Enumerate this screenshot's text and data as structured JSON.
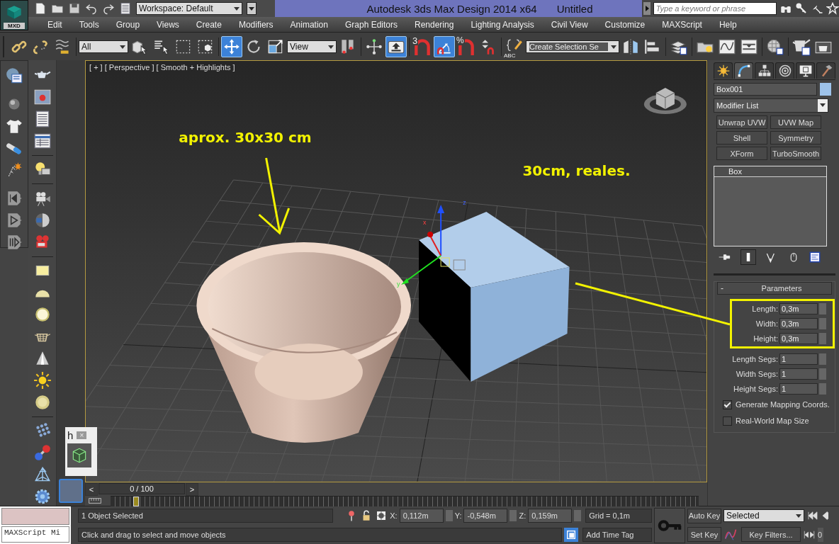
{
  "app_button": {
    "label": "MXD"
  },
  "quick_access": {
    "workspace": "Workspace: Default"
  },
  "window": {
    "title": "Autodesk 3ds Max Design 2014 x64",
    "document": "Untitled"
  },
  "search": {
    "placeholder": "Type a keyword or phrase"
  },
  "menu": [
    "Edit",
    "Tools",
    "Group",
    "Views",
    "Create",
    "Modifiers",
    "Animation",
    "Graph Editors",
    "Rendering",
    "Lighting Analysis",
    "Civil View",
    "Customize",
    "MAXScript",
    "Help"
  ],
  "toolbar": {
    "selection_filter": "All",
    "reference_coord": "View",
    "snap_dimension": "3",
    "percent_sign": "%",
    "named_sets_caption": "ABC",
    "named_selection": "Create Selection Se",
    "tools": [
      {
        "selected": false
      },
      {
        "selected": false
      },
      {
        "selected": false
      },
      {
        "selected": false
      },
      {
        "selected": false
      },
      {
        "selected": false
      },
      {
        "selected": false
      },
      {
        "selected": true
      },
      {
        "selected": false
      },
      {
        "selected": false
      },
      {
        "selected": false
      },
      {
        "selected": false
      },
      {
        "selected": true
      },
      {
        "selected": false
      },
      {
        "selected": true
      },
      {
        "selected": false
      },
      {
        "selected": false
      },
      {
        "selected": false
      },
      {
        "selected": false
      },
      {
        "selected": false
      },
      {
        "selected": false
      },
      {
        "selected": false
      },
      {
        "selected": false
      },
      {
        "selected": false
      },
      {
        "selected": false
      },
      {
        "selected": false
      },
      {
        "selected": false
      }
    ]
  },
  "viewport": {
    "label": "[ + ] [ Perspective ] [ Smooth + Highlights ]",
    "active": true,
    "annotations": [
      "aprox. 30x30 cm",
      "30cm, reales."
    ],
    "gizmo_axes": [
      "z",
      "x",
      "y"
    ]
  },
  "floating_panel": {
    "title": "h",
    "close": "×"
  },
  "command_panel": {
    "tabs": [
      {
        "selected": false
      },
      {
        "selected": true
      },
      {
        "selected": false
      },
      {
        "selected": false
      },
      {
        "selected": false
      },
      {
        "selected": false
      }
    ],
    "object_name": "Box001",
    "modifier_list": "Modifier List",
    "modifier_buttons": [
      "Unwrap UVW",
      "UVW Map",
      "Shell",
      "Symmetry",
      "XForm",
      "TurboSmooth"
    ],
    "stack": [
      {
        "label": "Box",
        "selected": false
      }
    ],
    "rollout": {
      "collapse": "-",
      "title": "Parameters",
      "fields": [
        {
          "label": "Length:",
          "value": "0,3m",
          "highlighted": true
        },
        {
          "label": "Width:",
          "value": "0,3m",
          "highlighted": true
        },
        {
          "label": "Height:",
          "value": "0,3m",
          "highlighted": true
        },
        {
          "label": "Length Segs:",
          "value": "1",
          "highlighted": false
        },
        {
          "label": "Width Segs:",
          "value": "1",
          "highlighted": false
        },
        {
          "label": "Height Segs:",
          "value": "1",
          "highlighted": false
        }
      ],
      "options": [
        {
          "label": "Generate Mapping Coords.",
          "checked": true
        },
        {
          "label": "Real-World Map Size",
          "checked": false
        }
      ]
    }
  },
  "timeline": {
    "prev": "<",
    "frame": "0 / 100",
    "next": ">"
  },
  "status_bar": {
    "listener": "MAXScript Mi",
    "selection": "1 Object Selected",
    "prompt": "Click and drag to select and move objects",
    "coords": [
      {
        "axis": "X:",
        "value": "0,112m"
      },
      {
        "axis": "Y:",
        "value": "-0,548m"
      },
      {
        "axis": "Z:",
        "value": "0,159m"
      }
    ],
    "grid": "Grid = 0,1m",
    "time_tag": "Add Time Tag",
    "auto_key": "Auto Key",
    "set_key": "Set Key",
    "key_mode": "Selected",
    "key_filters": "Key Filters...",
    "frame": "0"
  }
}
